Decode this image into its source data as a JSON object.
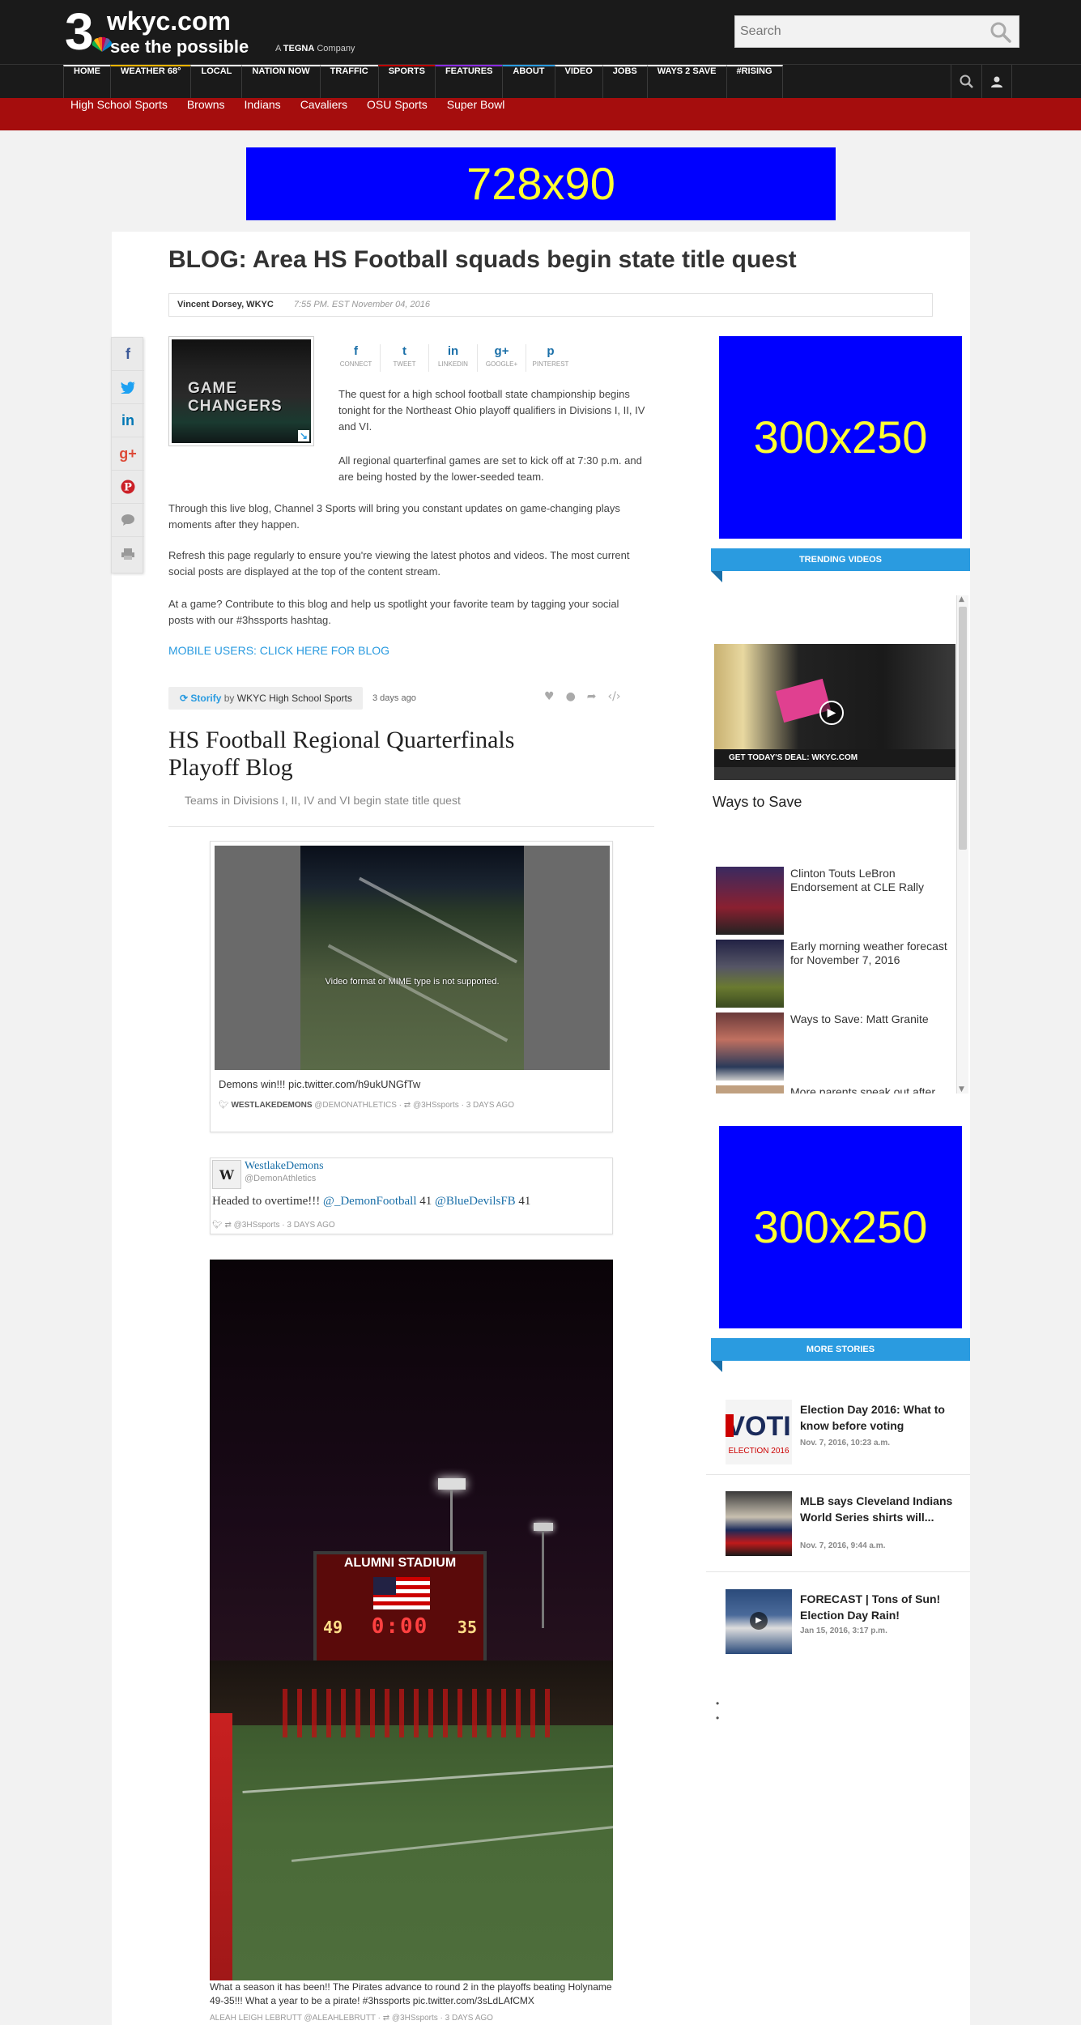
{
  "header": {
    "logo_number": "3",
    "site_name": "wkyc.com",
    "tagline": "see the possible",
    "tegna_prefix": "A",
    "tegna_name": "TEGNA",
    "tegna_suffix": "Company",
    "search_placeholder": "Search"
  },
  "nav": {
    "items": [
      "HOME",
      "WEATHER 68°",
      "LOCAL",
      "NATION NOW",
      "TRAFFIC",
      "SPORTS",
      "FEATURES",
      "ABOUT",
      "VIDEO",
      "JOBS",
      "WAYS 2 SAVE",
      "#RISING"
    ],
    "accent_colors": [
      "#ffffff",
      "#f4b400",
      "#ffffff",
      "#ffffff",
      "#ffffff",
      "#c00000",
      "#8a2be2",
      "#2a9be0",
      "#ffffff",
      "#ffffff",
      "#ffffff",
      "#ffffff"
    ]
  },
  "subnav": {
    "items": [
      "High School Sports",
      "Browns",
      "Indians",
      "Cavaliers",
      "OSU Sports",
      "Super Bowl"
    ]
  },
  "ads": {
    "banner": "728x90",
    "rect1": "300x250",
    "rect2": "300x250"
  },
  "article": {
    "title": "BLOG: Area HS Football squads begin state title quest",
    "author": "Vincent Dorsey, WKYC",
    "date": "7:55 PM. EST November 04, 2016",
    "thumb_text": "GAME CHANGERS",
    "social": [
      {
        "glyph": "f",
        "label": "CONNECT"
      },
      {
        "glyph": "t",
        "label": "TWEET"
      },
      {
        "glyph": "in",
        "label": "LINKEDIN"
      },
      {
        "glyph": "g+",
        "label": "GOOGLE+"
      },
      {
        "glyph": "p",
        "label": "PINTEREST"
      }
    ],
    "para1": "The quest for a high school football state championship begins tonight for the Northeast Ohio playoff qualifiers in Divisions I, II, IV and VI.",
    "para2": "All regional quarterfinal games are set to kick off at 7:30 p.m. and are being hosted by the lower-seeded team.",
    "para3": "Through this live blog, Channel 3 Sports will bring you constant updates on game-changing plays moments after they happen.",
    "para4": "Refresh this page regularly to ensure you're viewing the latest photos and videos. The most current social posts are displayed at the top of the content stream.",
    "para5": "At a game? Contribute to this blog and help us spotlight your favorite team by tagging your social posts with our #3hssports hashtag.",
    "mobile_link": "MOBILE USERS: CLICK HERE FOR BLOG"
  },
  "storify": {
    "brand": "Storify",
    "by": "by",
    "account": "WKYC High School Sports",
    "ago": "3 days ago",
    "title": "HS Football Regional Quarterfinals Playoff Blog",
    "subtitle": "Teams in Divisions I, II, IV and VI begin state title quest"
  },
  "posts": {
    "video_msg": "Video format or MIME type is not supported.",
    "tweet1_text": "Demons win!!! pic.twitter.com/h9ukUNGfTw",
    "tweet1_user": "WESTLAKEDEMONS",
    "tweet1_handle": "@DEMONATHLETICS",
    "tweet1_via": "@3HSsports",
    "tweet1_time": "3 DAYS AGO",
    "tweet2_name": "WestlakeDemons",
    "tweet2_handle": "@DemonAthletics",
    "tweet2_text_start": "Headed to overtime!!!",
    "tweet2_link1": "@_DemonFootball",
    "tweet2_score1": "41",
    "tweet2_link2": "@BlueDevilsFB",
    "tweet2_score2": "41",
    "tweet2_via": "@3HSsports",
    "tweet2_time": "3 DAYS AGO",
    "photo_stadium": "ALUMNI STADIUM",
    "photo_score_left": "49",
    "photo_clock": "0:00",
    "photo_score_right": "35",
    "photo_caption": "What a season it has been!! The Pirates advance to round 2 in the playoffs beating Holyname 49-35!!! What a year to be a pirate! #3hssports pic.twitter.com/3sLdLAfCMX",
    "photo_user": "ALEAH LEIGH LEBRUTT",
    "photo_handle": "@ALEAHLEBRUTT",
    "photo_via": "@3HSsports",
    "photo_time": "3 DAYS AGO"
  },
  "trending": {
    "heading": "TRENDING VIDEOS",
    "main_lower": "GET TODAY'S DEAL: WKYC.COM",
    "main_title": "Ways to Save",
    "items": [
      "Clinton Touts LeBron Endorsement at CLE Rally",
      "Early morning weather forecast for November 7, 2016",
      "Ways to Save: Matt Granite",
      "More parents speak out after"
    ]
  },
  "more_stories": {
    "heading": "MORE STORIES",
    "items": [
      {
        "title": "Election Day 2016: What to know before voting",
        "date": "Nov. 7, 2016, 10:23 a.m."
      },
      {
        "title": "MLB says Cleveland Indians World Series shirts will...",
        "date": "Nov. 7, 2016, 9:44 a.m."
      },
      {
        "title": "FORECAST | Tons of Sun! Election Day Rain!",
        "date": "Jan 15, 2016, 3:17 p.m."
      }
    ]
  }
}
